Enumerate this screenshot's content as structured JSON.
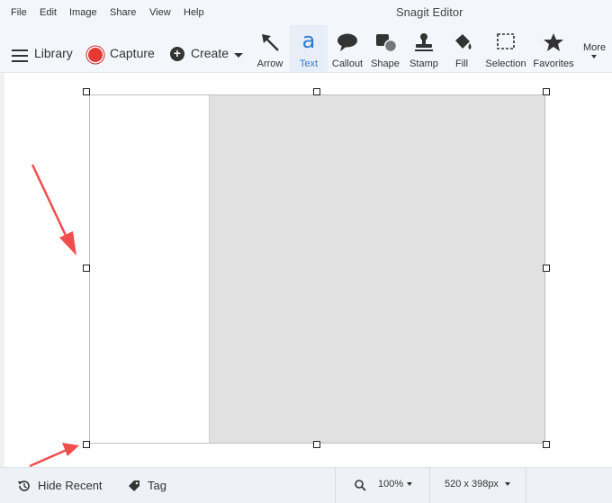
{
  "menu": [
    "File",
    "Edit",
    "Image",
    "Share",
    "View",
    "Help"
  ],
  "app_title": "Snagit Editor",
  "toolbar": {
    "library": "Library",
    "capture": "Capture",
    "create": "Create",
    "tools": [
      {
        "name": "arrow",
        "label": "Arrow",
        "icon": "arrow-icon"
      },
      {
        "name": "text",
        "label": "Text",
        "icon": "text-icon",
        "glyph": "a"
      },
      {
        "name": "callout",
        "label": "Callout",
        "icon": "callout-icon"
      },
      {
        "name": "shape",
        "label": "Shape",
        "icon": "shape-icon"
      },
      {
        "name": "stamp",
        "label": "Stamp",
        "icon": "stamp-icon"
      },
      {
        "name": "fill",
        "label": "Fill",
        "icon": "fill-icon"
      },
      {
        "name": "selection",
        "label": "Selection",
        "icon": "selection-icon"
      },
      {
        "name": "favorites",
        "label": "Favorites",
        "icon": "star-icon"
      }
    ],
    "more": "More"
  },
  "status": {
    "hide_recent": "Hide Recent",
    "tag": "Tag",
    "zoom": "100%",
    "dimensions": "520 x 398px"
  },
  "colors": {
    "accent": "#2f7bd3",
    "capture_red": "#e53935",
    "annotation_arrow": "#f04e4e",
    "image_gray": "#e1e1e1"
  }
}
